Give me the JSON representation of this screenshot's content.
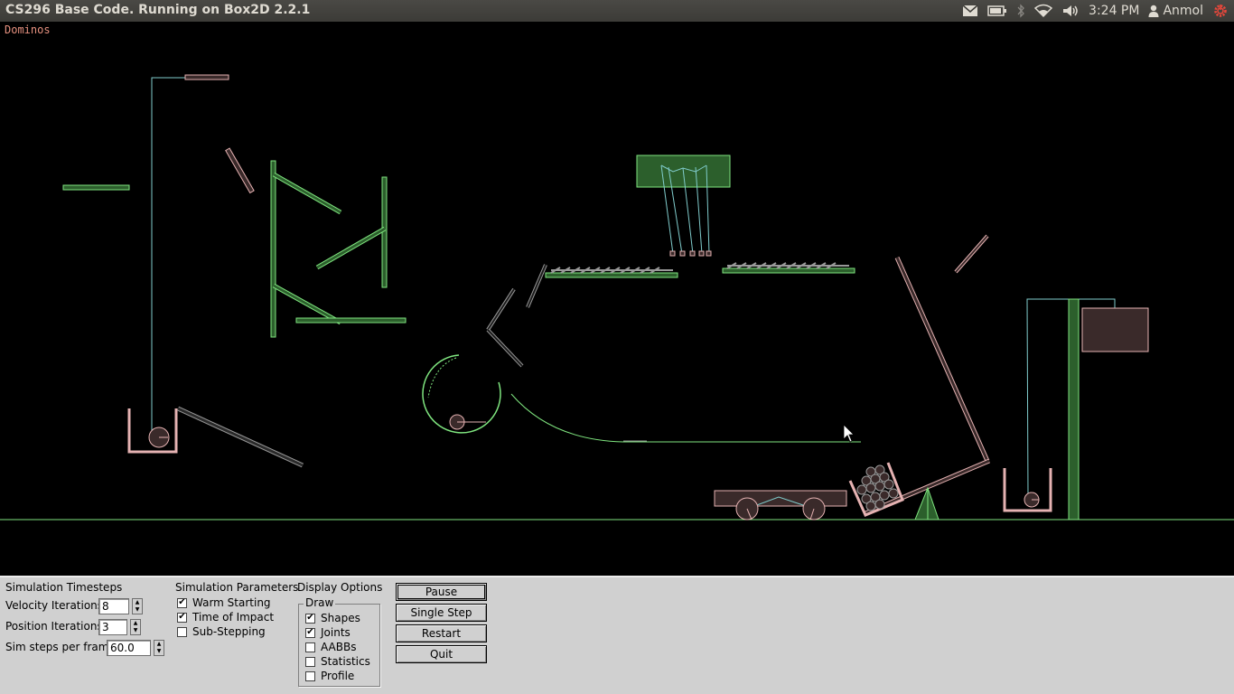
{
  "window": {
    "title": "CS296 Base Code. Running on Box2D 2.2.1"
  },
  "tray": {
    "icons": [
      "mail-icon",
      "battery-icon",
      "bluetooth-icon",
      "wifi-icon",
      "volume-icon"
    ],
    "clock": "3:24 PM",
    "user": "Anmol",
    "session_icon": "power-gear-icon"
  },
  "scene": {
    "title": "Dominos",
    "colors": {
      "static": "#7fe57f",
      "dynamic": "#e5b2b2",
      "joint": "#80cccc",
      "sleeping": "#999999",
      "fill_static": "#2c5f2c",
      "fill_dynamic": "#3a2a2a"
    }
  },
  "panel": {
    "timesteps": {
      "title": "Simulation Timesteps",
      "velocity_label": "Velocity Iterations",
      "velocity_value": "8",
      "position_label": "Position Iterations",
      "position_value": "3",
      "steps_label": "Sim steps per frame",
      "steps_value": "60.0"
    },
    "params": {
      "title": "Simulation Parameters",
      "items": [
        {
          "label": "Warm Starting",
          "checked": true
        },
        {
          "label": "Time of Impact",
          "checked": true
        },
        {
          "label": "Sub-Stepping",
          "checked": false
        }
      ]
    },
    "display": {
      "title": "Display Options",
      "draw_legend": "Draw",
      "items": [
        {
          "label": "Shapes",
          "checked": true
        },
        {
          "label": "Joints",
          "checked": true
        },
        {
          "label": "AABBs",
          "checked": false
        },
        {
          "label": "Statistics",
          "checked": false
        },
        {
          "label": "Profile",
          "checked": false
        }
      ]
    },
    "buttons": {
      "pause": "Pause",
      "single_step": "Single Step",
      "restart": "Restart",
      "quit": "Quit"
    }
  }
}
